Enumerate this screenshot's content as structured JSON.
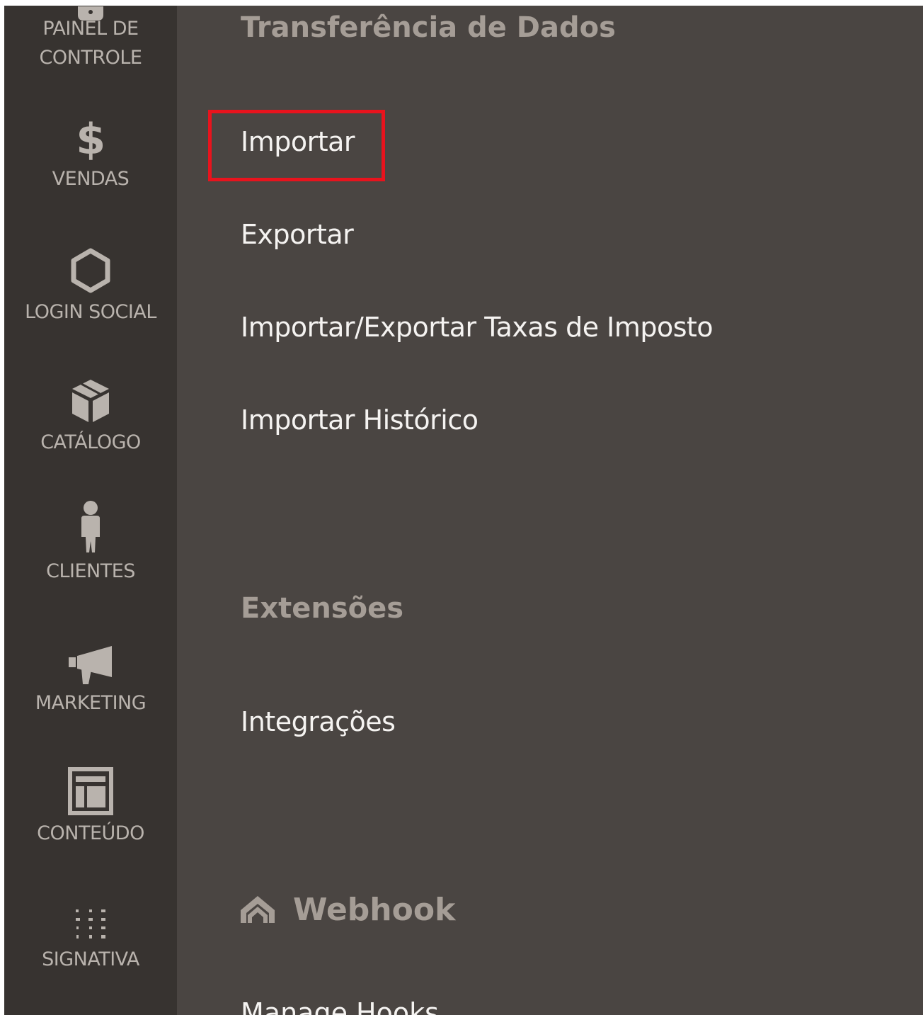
{
  "sidebar": {
    "items": [
      {
        "label_line1": "PAINEL DE",
        "label_line2": "CONTROLE",
        "icon": "dashboard-icon"
      },
      {
        "label": "VENDAS",
        "icon": "dollar-icon",
        "glyph": "$"
      },
      {
        "label": "LOGIN SOCIAL",
        "icon": "hexagon-icon"
      },
      {
        "label": "CATÁLOGO",
        "icon": "box-icon"
      },
      {
        "label": "CLIENTES",
        "icon": "person-icon"
      },
      {
        "label": "MARKETING",
        "icon": "megaphone-icon"
      },
      {
        "label": "CONTEÚDO",
        "icon": "layout-icon"
      },
      {
        "label": "SIGNATIVA",
        "icon": "signativa-logo-icon"
      }
    ]
  },
  "panel": {
    "data_transfer": {
      "title": "Transferência de Dados",
      "links": [
        "Importar",
        "Exportar",
        "Importar/Exportar Taxas de Imposto",
        "Importar Histórico"
      ]
    },
    "extensions": {
      "title": "Extensões",
      "links": [
        "Integrações"
      ]
    },
    "webhook": {
      "title": "Webhook",
      "icon": "webhook-logo-icon",
      "partial_link": "Manage Hooks"
    }
  },
  "colors": {
    "sidebar_bg": "#373330",
    "panel_bg": "#4a4542",
    "section_title": "#a59d96",
    "link": "#f5f3f1",
    "highlight": "#e8131d"
  }
}
